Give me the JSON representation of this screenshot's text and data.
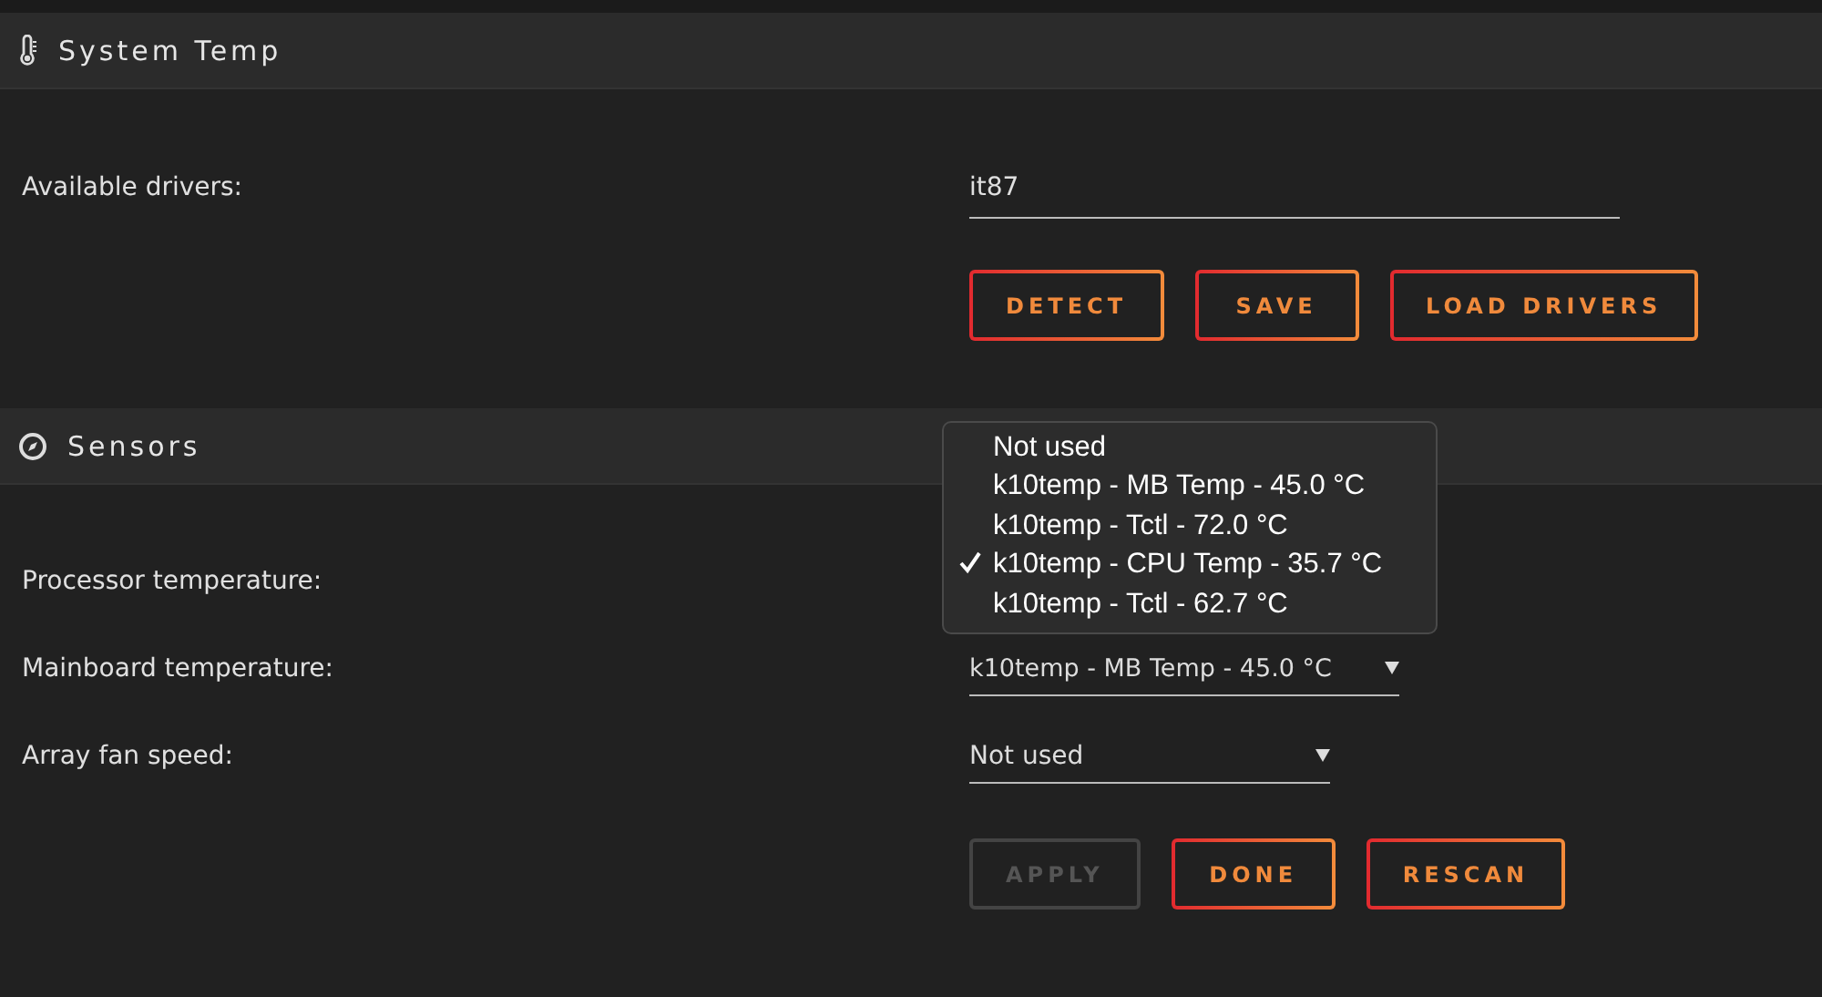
{
  "system_temp": {
    "title": "System Temp",
    "fields": [
      {
        "kind": "text",
        "label": "Available drivers:",
        "value": "it87"
      }
    ],
    "buttons": [
      {
        "label": "DETECT",
        "disabled": false
      },
      {
        "label": "SAVE",
        "disabled": false
      },
      {
        "label": "LOAD DRIVERS",
        "disabled": false
      }
    ]
  },
  "sensors": {
    "title": "Sensors",
    "fields": [
      {
        "kind": "select",
        "label": "Processor temperature:",
        "expanded": true,
        "options": [
          {
            "label": "Not used",
            "selected": false
          },
          {
            "label": "k10temp - MB Temp - 45.0 °C",
            "selected": false
          },
          {
            "label": "k10temp - Tctl - 72.0 °C",
            "selected": false
          },
          {
            "label": "k10temp - CPU Temp - 35.7 °C",
            "selected": true
          },
          {
            "label": "k10temp - Tctl - 62.7 °C",
            "selected": false
          }
        ]
      },
      {
        "kind": "select",
        "label": "Mainboard temperature:",
        "expanded": false,
        "value": "k10temp - MB Temp - 45.0 °C"
      },
      {
        "kind": "select",
        "label": "Array fan speed:",
        "expanded": false,
        "value": "Not used"
      }
    ],
    "buttons": [
      {
        "label": "APPLY",
        "disabled": true
      },
      {
        "label": "DONE",
        "disabled": false
      },
      {
        "label": "RESCAN",
        "disabled": false
      }
    ]
  }
}
